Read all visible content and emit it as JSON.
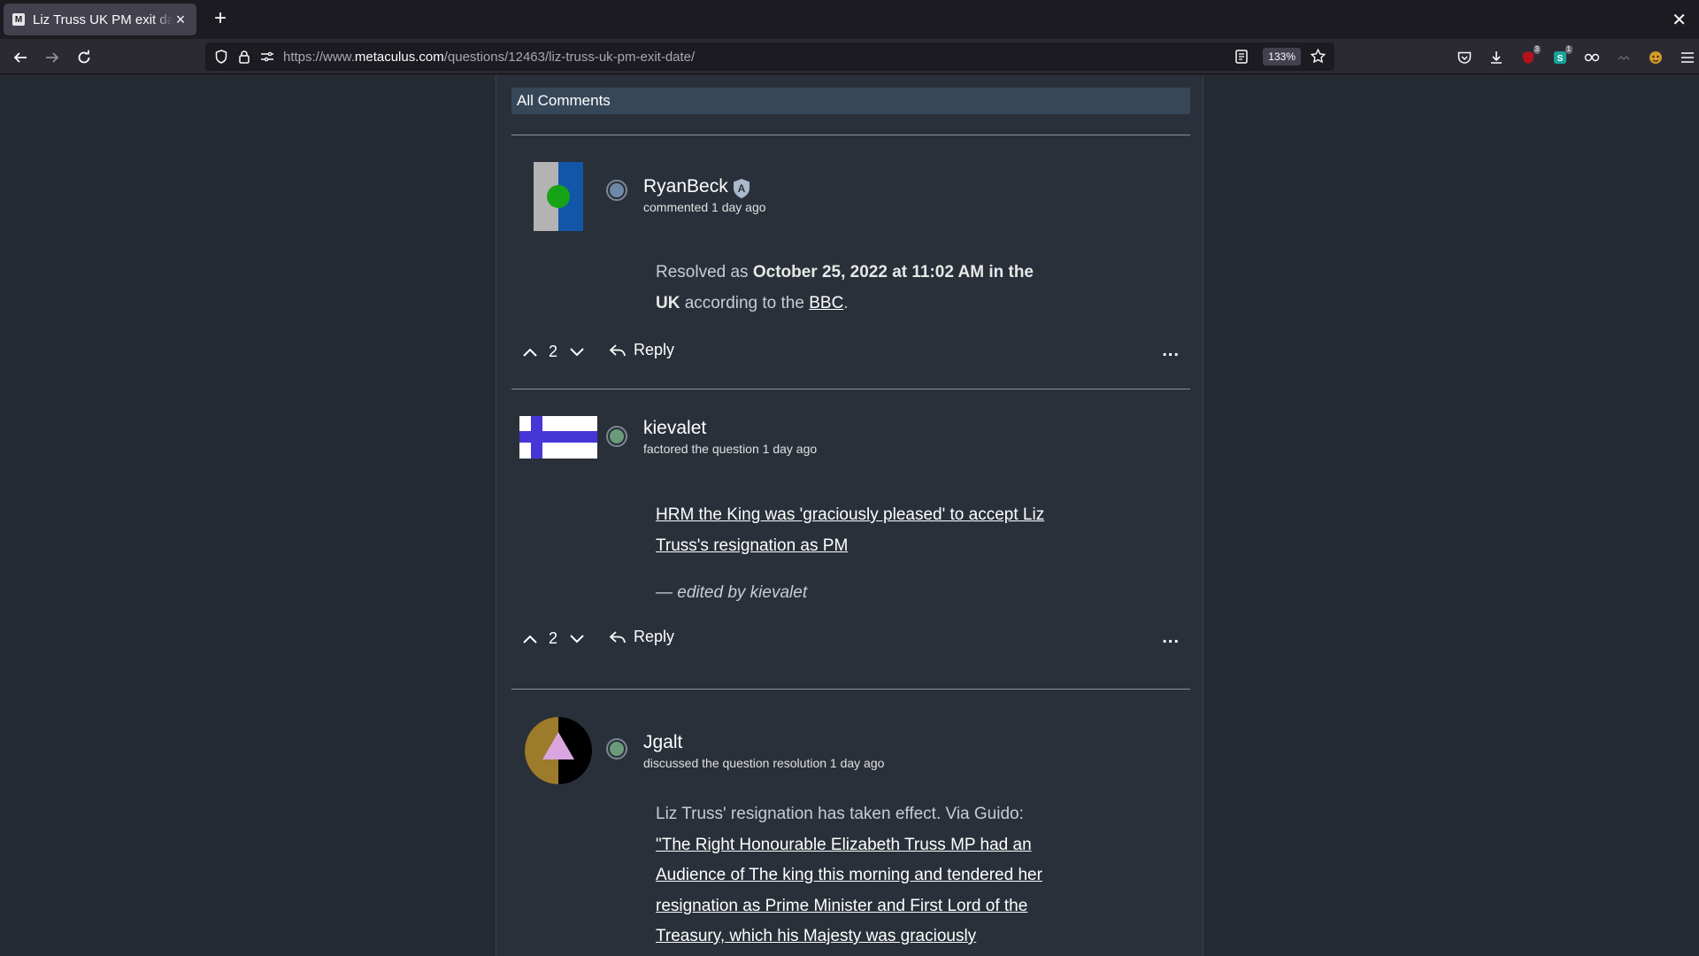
{
  "browser": {
    "tab_title": "Liz Truss UK PM exit date",
    "favicon_letter": "M",
    "url_prefix": "https://www.",
    "url_host": "metaculus.com",
    "url_path": "/questions/12463/liz-truss-uk-pm-exit-date/",
    "zoom": "133%",
    "extension_badges": [
      "3",
      "1"
    ]
  },
  "section": {
    "title": "All Comments"
  },
  "comments": [
    {
      "username": "RyanBeck",
      "meta": "commented 1 day ago",
      "body_prefix": "Resolved as ",
      "body_bold": "October 25, 2022 at 11:02 AM in the UK",
      "body_middle": " according to the ",
      "body_link": "BBC",
      "body_suffix": ".",
      "votes": "2",
      "reply_label": "Reply",
      "more": "..."
    },
    {
      "username": "kievalet",
      "meta": "factored the question 1 day ago",
      "body_link": "HRM the King was 'graciously pleased' to accept Liz Truss's resignation as PM",
      "edited": "— edited by kievalet",
      "votes": "2",
      "reply_label": "Reply",
      "more": "..."
    },
    {
      "username": "Jgalt",
      "meta": "discussed the question resolution 1 day ago",
      "body_prefix": "Liz Truss' resignation has taken effect. Via Guido: ",
      "body_link": "\"The Right Honourable Elizabeth Truss MP had an Audience of The king this morning and tendered her resignation as Prime Minister and First Lord of the Treasury, which his Majesty was graciously"
    }
  ],
  "colors": {
    "page_bg": "#262b33",
    "column_bg": "#293039",
    "header_bg": "#37475a"
  }
}
